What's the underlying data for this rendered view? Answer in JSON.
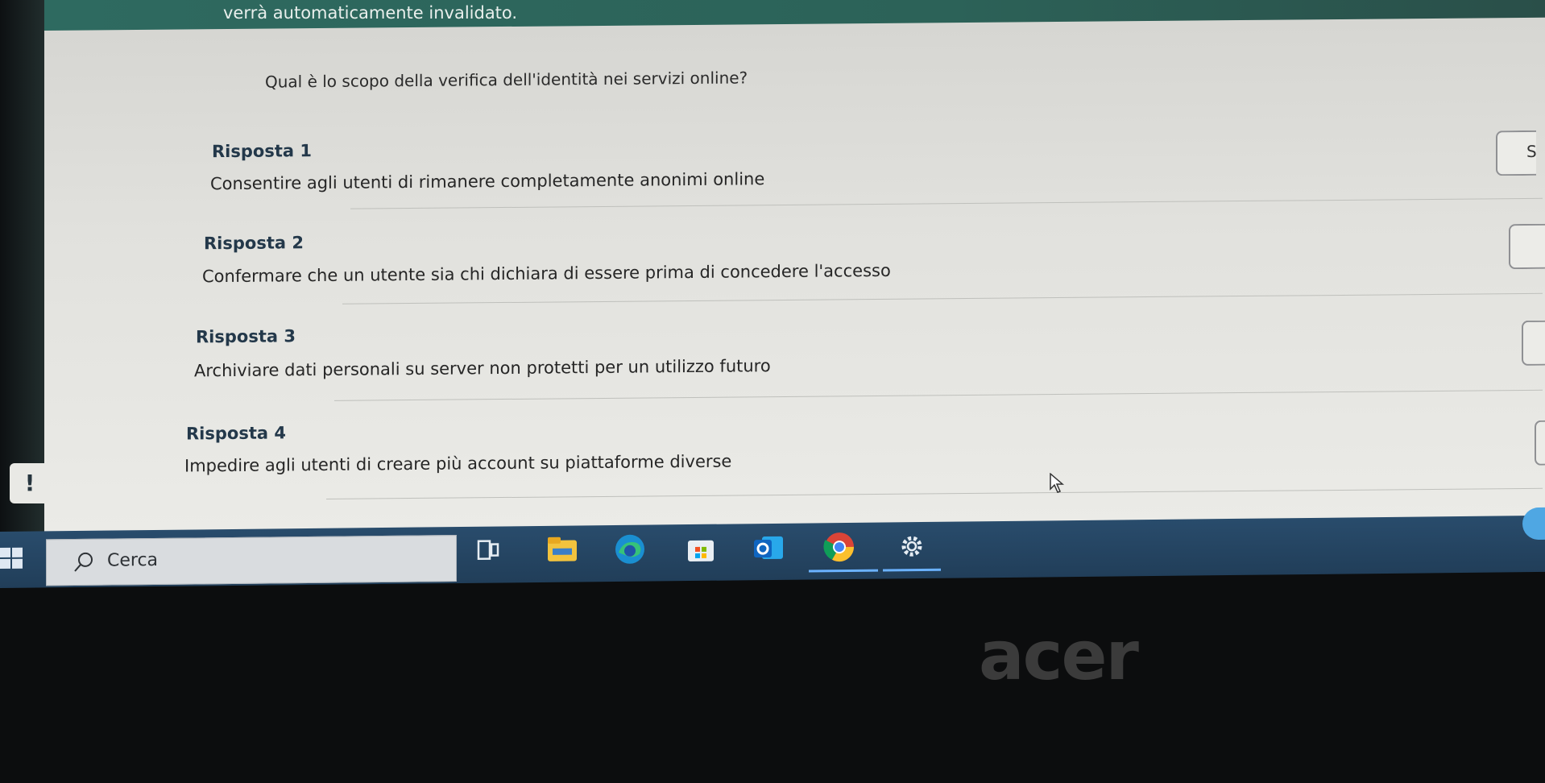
{
  "top_banner": "verrà automaticamente invalidato.",
  "question": "Qual è lo scopo della verifica dell'identità nei servizi online?",
  "answers": [
    {
      "label": "Risposta 1",
      "text": "Consentire agli utenti di rimanere completamente anonimi online",
      "select_value": "S"
    },
    {
      "label": "Risposta 2",
      "text": "Confermare che un utente sia chi dichiara di essere prima di concedere l'accesso",
      "select_value": ""
    },
    {
      "label": "Risposta 3",
      "text": "Archiviare dati personali su server non protetti per un utilizzo futuro",
      "select_value": ""
    },
    {
      "label": "Risposta 4",
      "text": "Impedire agli utenti di creare più account su piattaforme diverse",
      "select_value": ""
    }
  ],
  "alert_glyph": "!",
  "taskbar": {
    "search_placeholder": "Cerca",
    "icons": [
      "task-view-icon",
      "file-explorer-icon",
      "edge-icon",
      "store-icon",
      "outlook-icon",
      "chrome-icon",
      "settings-icon"
    ]
  },
  "brand_logo": "acer"
}
